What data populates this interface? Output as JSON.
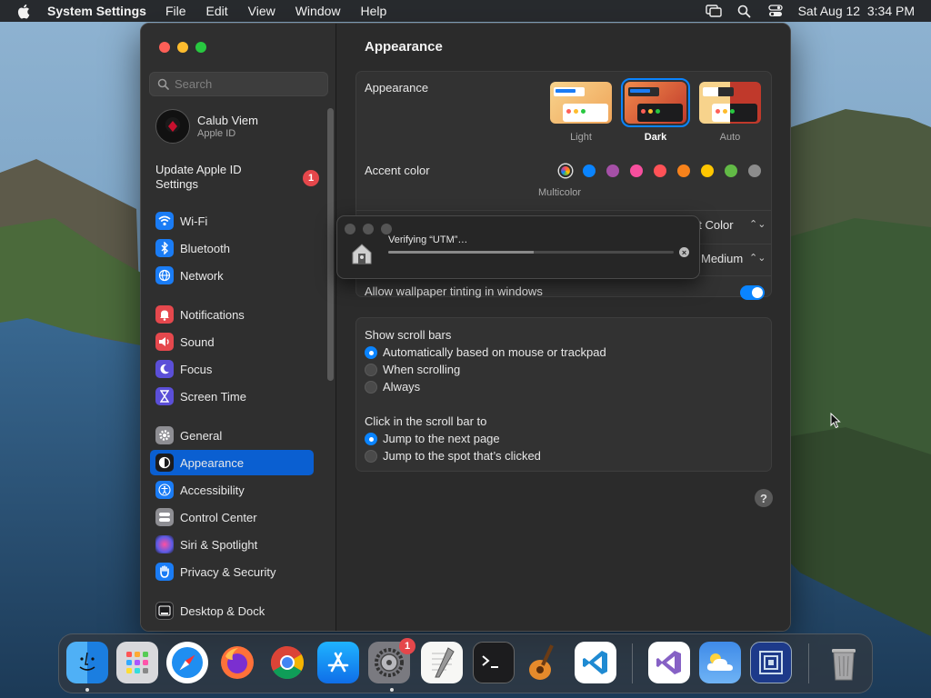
{
  "menubar": {
    "app_name": "System Settings",
    "menus": [
      "File",
      "Edit",
      "View",
      "Window",
      "Help"
    ],
    "clock": "Sat Aug 12  3:34 PM"
  },
  "sidebar": {
    "search_placeholder": "Search",
    "profile": {
      "name": "Calub Viem",
      "subtitle": "Apple ID"
    },
    "update": {
      "label": "Update Apple ID Settings",
      "badge": "1"
    },
    "items": [
      {
        "label": "Wi-Fi",
        "icon": "wifi-icon",
        "color": "#1a7cf5"
      },
      {
        "label": "Bluetooth",
        "icon": "bluetooth-icon",
        "color": "#1a7cf5"
      },
      {
        "label": "Network",
        "icon": "globe-icon",
        "color": "#1a7cf5"
      },
      {
        "label": "Notifications",
        "icon": "bell-icon",
        "color": "#e5484d"
      },
      {
        "label": "Sound",
        "icon": "speaker-icon",
        "color": "#e5484d"
      },
      {
        "label": "Focus",
        "icon": "moon-icon",
        "color": "#5b4fd8"
      },
      {
        "label": "Screen Time",
        "icon": "hourglass-icon",
        "color": "#5b4fd8"
      },
      {
        "label": "General",
        "icon": "gear-icon",
        "color": "#8e8e93"
      },
      {
        "label": "Appearance",
        "icon": "appearance-icon",
        "color": "#1c1c1e"
      },
      {
        "label": "Accessibility",
        "icon": "accessibility-icon",
        "color": "#1a7cf5"
      },
      {
        "label": "Control Center",
        "icon": "control-center-icon",
        "color": "#8e8e93"
      },
      {
        "label": "Siri & Spotlight",
        "icon": "siri-icon",
        "color": "#a24ad6"
      },
      {
        "label": "Privacy & Security",
        "icon": "hand-icon",
        "color": "#1a7cf5"
      },
      {
        "label": "Desktop & Dock",
        "icon": "dock-icon",
        "color": "#1c1c1e"
      }
    ],
    "active": "Appearance"
  },
  "content": {
    "title": "Appearance",
    "appearance": {
      "label": "Appearance",
      "options": [
        {
          "label": "Light",
          "selected": false
        },
        {
          "label": "Dark",
          "selected": true
        },
        {
          "label": "Auto",
          "selected": false
        }
      ]
    },
    "accent": {
      "label": "Accent color",
      "selected_label": "Multicolor",
      "colors": [
        "multicolor",
        "#0a84ff",
        "#a550a7",
        "#f74f9e",
        "#ff5257",
        "#f7821b",
        "#ffc600",
        "#62ba46",
        "#8c8c8c"
      ]
    },
    "highlight_value": "nt Color",
    "sidebar_icon_size_value": "Medium",
    "wallpaper_tinting": {
      "label": "Allow wallpaper tinting in windows",
      "on": true
    },
    "scroll_bars": {
      "label": "Show scroll bars",
      "options": [
        {
          "label": "Automatically based on mouse or trackpad",
          "selected": true
        },
        {
          "label": "When scrolling",
          "selected": false
        },
        {
          "label": "Always",
          "selected": false
        }
      ]
    },
    "click_scroll": {
      "label": "Click in the scroll bar to",
      "options": [
        {
          "label": "Jump to the next page",
          "selected": true
        },
        {
          "label": "Jump to the spot that’s clicked",
          "selected": false
        }
      ]
    },
    "help": "?"
  },
  "verify_dialog": {
    "title": "Verifying “UTM”…",
    "progress": 0.51
  },
  "dock": {
    "apps": [
      "Finder",
      "Launchpad",
      "Safari",
      "Firefox",
      "Chrome",
      "App Store",
      "System Settings",
      "TextEdit",
      "Terminal",
      "GarageBand",
      "Visual Studio Code",
      "Visual Studio",
      "Weather",
      "Preview",
      "Trash"
    ],
    "settings_badge": "1"
  }
}
